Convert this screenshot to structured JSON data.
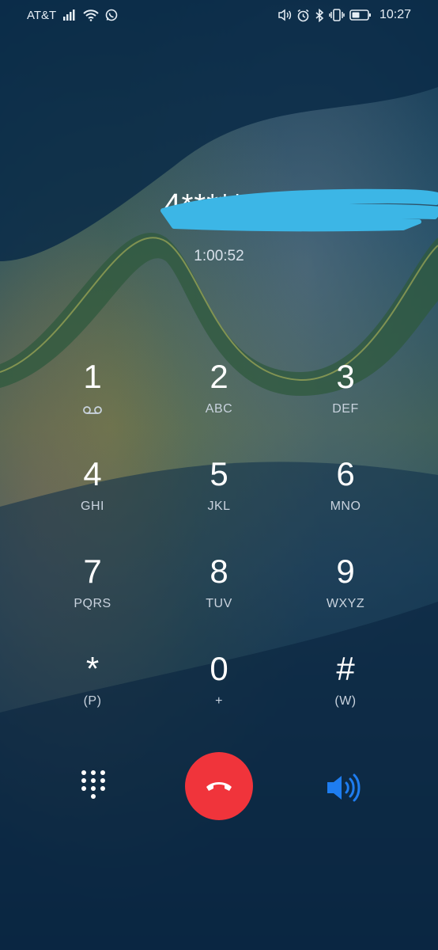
{
  "status_bar": {
    "carrier": "AT&T",
    "time": "10:27",
    "icons": [
      "signal-icon",
      "wifi-icon",
      "whatsapp-icon",
      "volume-icon",
      "alarm-icon",
      "bluetooth-icon",
      "vibrate-icon",
      "battery-icon"
    ]
  },
  "call": {
    "number": "4******1",
    "duration": "1:00:52"
  },
  "keypad": [
    {
      "digit": "1",
      "letters": ""
    },
    {
      "digit": "2",
      "letters": "ABC"
    },
    {
      "digit": "3",
      "letters": "DEF"
    },
    {
      "digit": "4",
      "letters": "GHI"
    },
    {
      "digit": "5",
      "letters": "JKL"
    },
    {
      "digit": "6",
      "letters": "MNO"
    },
    {
      "digit": "7",
      "letters": "PQRS"
    },
    {
      "digit": "8",
      "letters": "TUV"
    },
    {
      "digit": "9",
      "letters": "WXYZ"
    },
    {
      "digit": "*",
      "letters": "(P)"
    },
    {
      "digit": "0",
      "letters": "+"
    },
    {
      "digit": "#",
      "letters": "(W)"
    }
  ],
  "actions": {
    "dialpad_icon": "dialpad-icon",
    "end_call_icon": "end-call-icon",
    "speaker_icon": "speaker-icon"
  },
  "colors": {
    "end_call": "#f0343b",
    "speaker_active": "#1e7df0",
    "scribble": "#3cb6e6"
  }
}
